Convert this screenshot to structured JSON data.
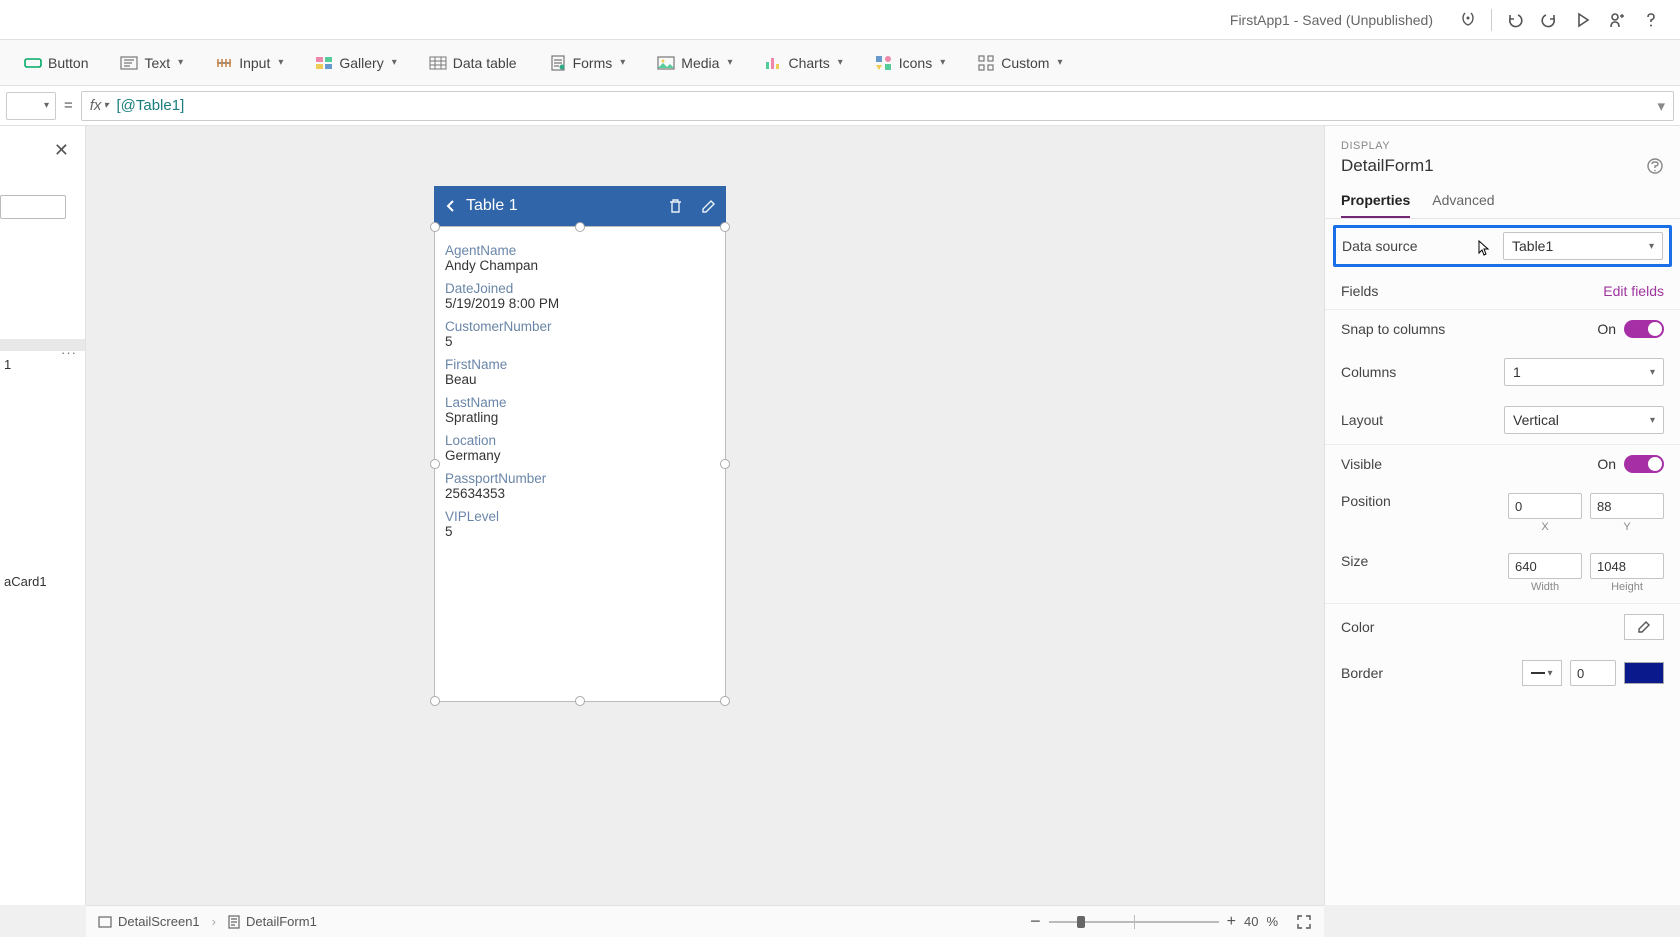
{
  "title": "FirstApp1 - Saved (Unpublished)",
  "ribbon": {
    "button": "Button",
    "text": "Text",
    "input": "Input",
    "gallery": "Gallery",
    "data_table": "Data table",
    "forms": "Forms",
    "media": "Media",
    "charts": "Charts",
    "icons": "Icons",
    "custom": "Custom"
  },
  "formula": {
    "fx": "fx",
    "expr": "[@Table1]",
    "eq": "="
  },
  "tree": {
    "form_node": "1",
    "card_node": "aCard1"
  },
  "device": {
    "header_title": "Table 1",
    "fields": [
      {
        "label": "AgentName",
        "value": "Andy Champan"
      },
      {
        "label": "DateJoined",
        "value": "5/19/2019 8:00 PM"
      },
      {
        "label": "CustomerNumber",
        "value": "5"
      },
      {
        "label": "FirstName",
        "value": "Beau"
      },
      {
        "label": "LastName",
        "value": "Spratling"
      },
      {
        "label": "Location",
        "value": "Germany"
      },
      {
        "label": "PassportNumber",
        "value": "25634353"
      },
      {
        "label": "VIPLevel",
        "value": "5"
      }
    ]
  },
  "props": {
    "section": "DISPLAY",
    "name": "DetailForm1",
    "tab_properties": "Properties",
    "tab_advanced": "Advanced",
    "data_source_label": "Data source",
    "data_source_value": "Table1",
    "fields_label": "Fields",
    "edit_fields": "Edit fields",
    "snap_label": "Snap to columns",
    "snap_value": "On",
    "columns_label": "Columns",
    "columns_value": "1",
    "layout_label": "Layout",
    "layout_value": "Vertical",
    "visible_label": "Visible",
    "visible_value": "On",
    "position_label": "Position",
    "position_x": "0",
    "position_y": "88",
    "position_x_sub": "X",
    "position_y_sub": "Y",
    "size_label": "Size",
    "size_w": "640",
    "size_h": "1048",
    "size_w_sub": "Width",
    "size_h_sub": "Height",
    "color_label": "Color",
    "border_label": "Border",
    "border_width": "0"
  },
  "footer": {
    "screen": "DetailScreen1",
    "form": "DetailForm1",
    "zoom": "40",
    "zoom_pct": "%"
  }
}
